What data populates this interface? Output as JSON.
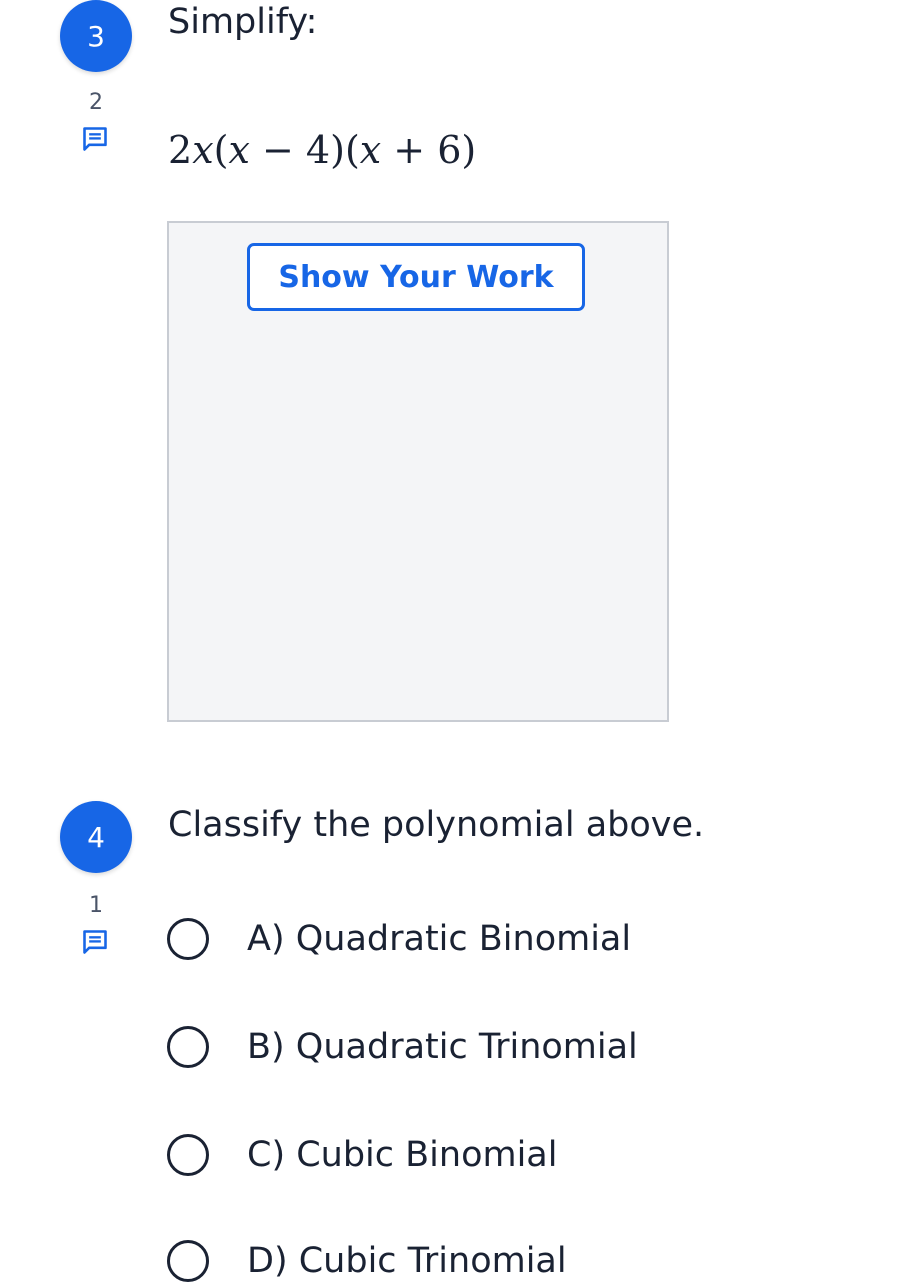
{
  "question3": {
    "number": "3",
    "comment_count": "2",
    "comment_icon": "comment-icon",
    "prompt": "Simplify:",
    "expression": {
      "coef": "2",
      "var1": "x",
      "open1": "(",
      "var2": "x",
      "minus": "−",
      "num1": "4",
      "close1": ")",
      "open2": "(",
      "var3": "x",
      "plus": "+",
      "num2": "6",
      "close2": ")"
    },
    "show_work_label": "Show Your Work"
  },
  "question4": {
    "number": "4",
    "comment_count": "1",
    "comment_icon": "comment-icon",
    "prompt": "Classify the polynomial above.",
    "choices": [
      {
        "label": "A) Quadratic Binomial",
        "selected": false
      },
      {
        "label": "B) Quadratic Trinomial",
        "selected": false
      },
      {
        "label": "C) Cubic Binomial",
        "selected": false
      },
      {
        "label": "D) Cubic Trinomial",
        "selected": false
      }
    ]
  },
  "colors": {
    "accent": "#1766e6",
    "text": "#1a2233",
    "work_area_bg": "#f4f5f7"
  }
}
